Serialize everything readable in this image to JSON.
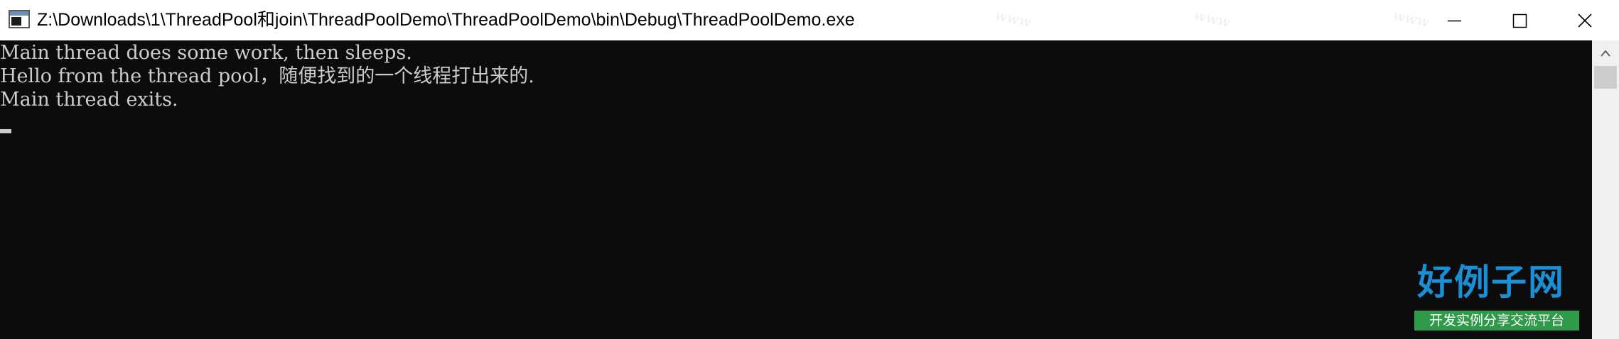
{
  "window": {
    "title": "Z:\\Downloads\\1\\ThreadPool和join\\ThreadPoolDemo\\ThreadPoolDemo\\bin\\Debug\\ThreadPoolDemo.exe",
    "icon": "console-app-icon",
    "controls": {
      "minimize_icon": "minimize-icon",
      "maximize_icon": "maximize-icon",
      "close_icon": "close-icon"
    }
  },
  "console": {
    "lines": [
      "Main thread does some work, then sleeps.",
      "Hello from the thread pool，随便找到的一个线程打出来的.",
      "Main thread exits."
    ],
    "text_color": "#cccccc",
    "background": "#0c0c0c"
  },
  "watermark": {
    "logo_main": "好例子网",
    "logo_sub": "开发实例分享交流平台",
    "logo_color": "#1a8fd6",
    "sub_background": "#2e9a4a"
  }
}
